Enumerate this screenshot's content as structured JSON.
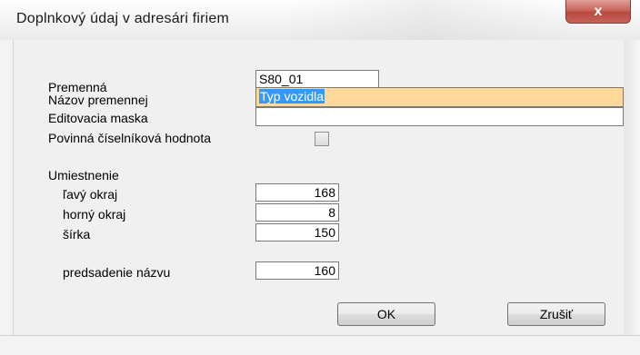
{
  "window": {
    "title": "Doplnkový údaj v adresári firiem",
    "close_glyph": "x"
  },
  "form": {
    "premenna": {
      "label": "Premenná",
      "value": "S80_01"
    },
    "nazov": {
      "label": "Názov premennej",
      "value": "Typ vozidla"
    },
    "maska": {
      "label": "Editovacia maska",
      "value": ""
    },
    "povinna": {
      "label": "Povinná číselníková hodnota",
      "checked": false
    }
  },
  "umiestnenie": {
    "heading": "Umiestnenie",
    "lavy": {
      "label": "ľavý okraj",
      "value": "168"
    },
    "horny": {
      "label": "horný okraj",
      "value": "8"
    },
    "sirka": {
      "label": "šírka",
      "value": "150"
    },
    "predsadenie": {
      "label": "predsadenie názvu",
      "value": "160"
    }
  },
  "buttons": {
    "ok": "OK",
    "cancel": "Zrušiť"
  },
  "colors": {
    "highlight_field": "#ffd99a",
    "selection": "#3399ff",
    "close_button": "#c9665c"
  }
}
